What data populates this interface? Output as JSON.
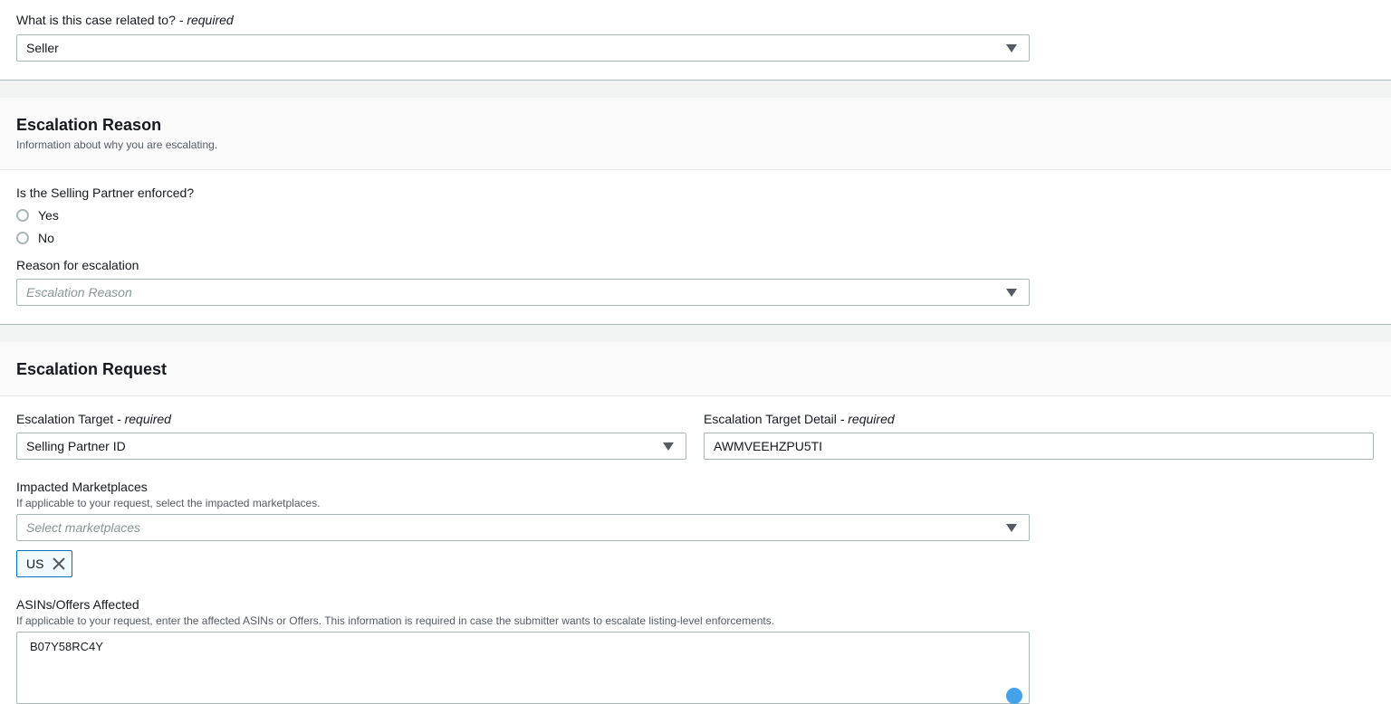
{
  "case_related": {
    "label": "What is this case related to?",
    "required": "- required",
    "value": "Seller"
  },
  "escalation_reason": {
    "title": "Escalation Reason",
    "description": "Information about why you are escalating.",
    "enforced_question": "Is the Selling Partner enforced?",
    "options": [
      "Yes",
      "No"
    ],
    "reason_label": "Reason for escalation",
    "reason_placeholder": "Escalation Reason"
  },
  "escalation_request": {
    "title": "Escalation Request",
    "target_label": "Escalation Target",
    "target_required": "- required",
    "target_value": "Selling Partner ID",
    "detail_label": "Escalation Target Detail",
    "detail_required": "- required",
    "detail_value": "AWMVEEHZPU5TI",
    "marketplaces_label": "Impacted Marketplaces",
    "marketplaces_desc": "If applicable to your request, select the impacted marketplaces.",
    "marketplaces_placeholder": "Select marketplaces",
    "selected_tokens": [
      "US"
    ],
    "asins_label": "ASINs/Offers Affected",
    "asins_desc": "If applicable to your request, enter the affected ASINs or Offers. This information is required in case the submitter wants to escalate listing-level enforcements.",
    "asins_value": "B07Y58RC4Y"
  },
  "icons": {
    "dropdown": "caret-down-icon",
    "remove_token": "close-icon",
    "radio": "radio-icon"
  },
  "colors": {
    "border": "#aab7b8",
    "token_border": "#0073bb",
    "token_bg": "#f1faff",
    "section_bg": "#fafafa",
    "gap_bg": "#f2f3f3"
  }
}
